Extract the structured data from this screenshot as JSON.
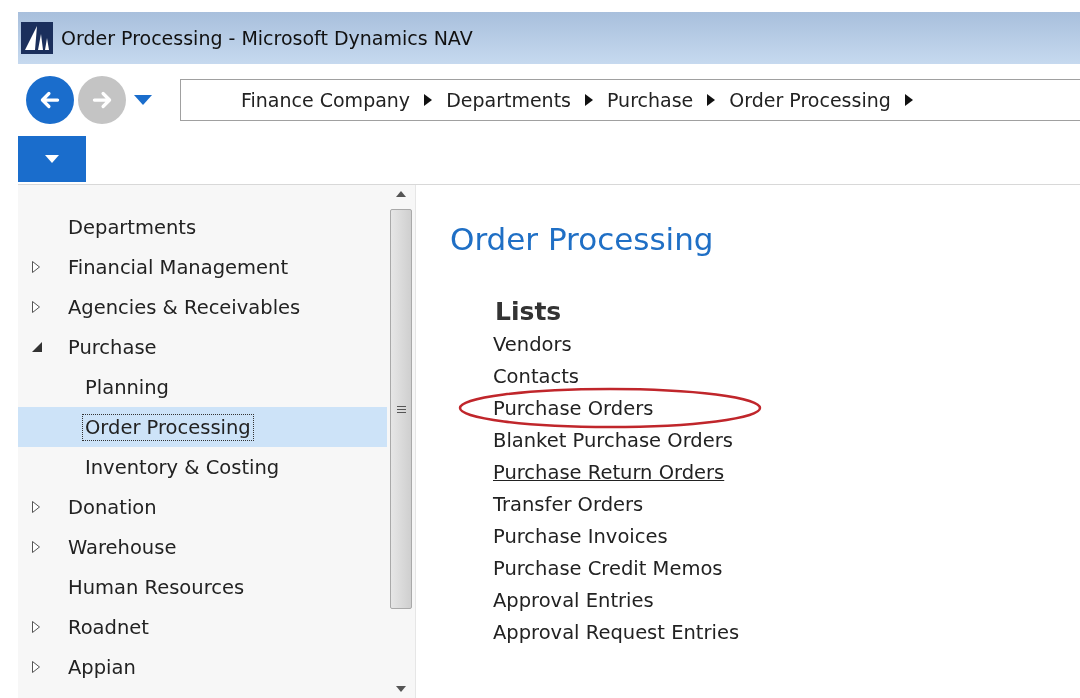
{
  "window": {
    "title": "Order Processing - Microsoft Dynamics NAV"
  },
  "navigation": {
    "back_enabled": true,
    "forward_enabled": false,
    "breadcrumb": [
      "Finance Company",
      "Departments",
      "Purchase",
      "Order Processing"
    ]
  },
  "sidebar": {
    "items": [
      {
        "label": "Departments",
        "selected": false
      },
      {
        "label": "Financial Management",
        "expanded": false,
        "selected": false
      },
      {
        "label": "Agencies & Receivables",
        "expanded": false,
        "selected": false
      },
      {
        "label": "Purchase",
        "expanded": true,
        "selected": false,
        "children": [
          {
            "label": "Planning",
            "selected": false
          },
          {
            "label": "Order Processing",
            "selected": true
          },
          {
            "label": "Inventory & Costing",
            "selected": false
          }
        ]
      },
      {
        "label": "Donation",
        "expanded": false,
        "selected": false
      },
      {
        "label": "Warehouse",
        "expanded": false,
        "selected": false
      },
      {
        "label": "Human Resources",
        "selected": false
      },
      {
        "label": "Roadnet",
        "expanded": false,
        "selected": false
      },
      {
        "label": "Appian",
        "expanded": false,
        "selected": false
      }
    ]
  },
  "content": {
    "title": "Order Processing",
    "section": "Lists",
    "links": [
      {
        "label": "Vendors",
        "circled": false,
        "hovered": false
      },
      {
        "label": "Contacts",
        "circled": false,
        "hovered": false
      },
      {
        "label": "Purchase Orders",
        "circled": true,
        "hovered": false
      },
      {
        "label": "Blanket Purchase Orders",
        "circled": false,
        "hovered": false
      },
      {
        "label": "Purchase Return Orders",
        "circled": false,
        "hovered": true
      },
      {
        "label": "Transfer Orders",
        "circled": false,
        "hovered": false
      },
      {
        "label": "Purchase Invoices",
        "circled": false,
        "hovered": false
      },
      {
        "label": "Purchase Credit Memos",
        "circled": false,
        "hovered": false
      },
      {
        "label": "Approval Entries",
        "circled": false,
        "hovered": false
      },
      {
        "label": "Approval Request Entries",
        "circled": false,
        "hovered": false
      }
    ]
  }
}
